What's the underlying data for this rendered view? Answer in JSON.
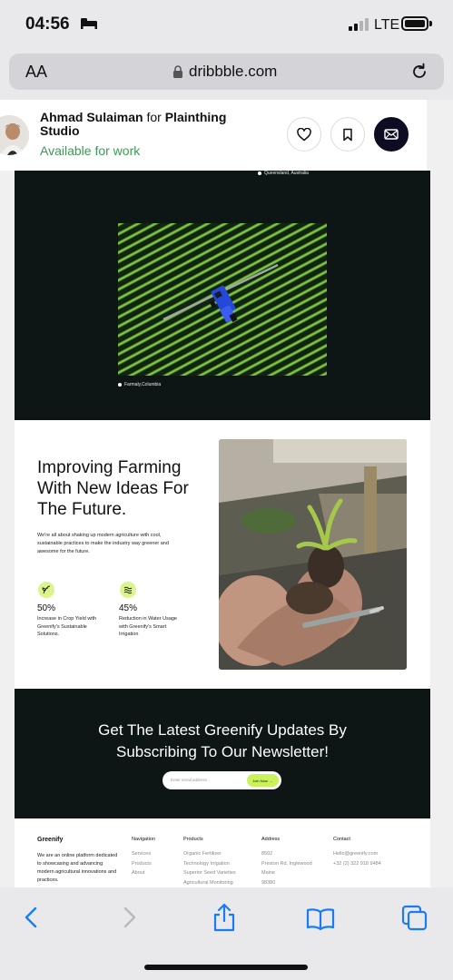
{
  "status": {
    "time": "04:56",
    "network": "LTE"
  },
  "browser": {
    "text_size": "AA",
    "url": "dribbble.com"
  },
  "profile": {
    "name": "Ahmad Sulaiman",
    "for_word": "for",
    "studio": "Plainthing Studio",
    "availability": "Available for work"
  },
  "shot": {
    "hero": {
      "location_top": "Queensland, Australia",
      "location_bottom": "Farmaly,Columbia"
    },
    "section": {
      "title_lines": [
        "Improving Farming",
        "With New Ideas For",
        "The Future."
      ],
      "description": "We're all about shaking up modern agriculture with cool, sustainable practices to make the industry way greener and awesome for the future.",
      "stats": [
        {
          "value": "50%",
          "label": "Increase in Crop Yield with Greenify's Sustainable Solutions."
        },
        {
          "value": "45%",
          "label": "Reduction in Water Usage with Greenify's Smart Irrigation"
        }
      ]
    },
    "newsletter": {
      "title_lines": [
        "Get The Latest Greenify Updates By",
        "Subscribing To Our Newsletter!"
      ],
      "placeholder": "Enter email address",
      "button": "Join Now"
    },
    "footer": {
      "brand": "Greenify",
      "description": "We are an online platform dedicated to showcasing and advancing modern agricultural innovations and practices.",
      "columns": [
        {
          "heading": "Navigation",
          "items": [
            "Services",
            "Products",
            "About"
          ]
        },
        {
          "heading": "Products",
          "items": [
            "Organic Fertilizer",
            "Technology Irrigation",
            "Superior Seed Varieties",
            "Agricultural Monitoring"
          ]
        },
        {
          "heading": "Address",
          "items": [
            "8502",
            "Preston Rd. Inglewood",
            "Maine",
            "98380"
          ]
        },
        {
          "heading": "Contact",
          "items": [
            "Hello@greenify.com",
            "+32 (2) 322 918 9484"
          ]
        }
      ]
    }
  },
  "colors": {
    "accent_green": "#c9f35a",
    "dark_bg": "#0d1615",
    "available": "#3d9a57",
    "ios_blue": "#1a7cf5"
  },
  "icons": [
    "bed-icon",
    "signal-icon",
    "battery-icon",
    "lock-icon",
    "reload-icon",
    "heart-icon",
    "bookmark-icon",
    "mail-icon",
    "back-icon",
    "forward-icon",
    "share-icon",
    "book-icon",
    "tabs-icon"
  ]
}
